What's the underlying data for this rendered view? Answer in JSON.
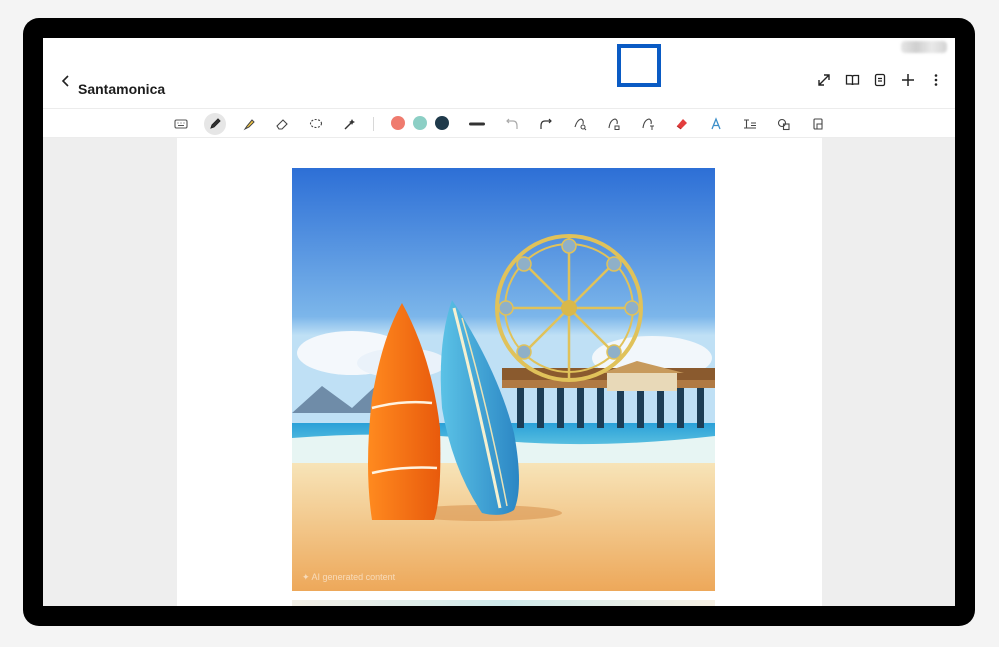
{
  "header": {
    "title": "Santamonica",
    "back_icon": "chevron-left-icon",
    "actions": [
      "expand-icon",
      "book-icon",
      "page-list-icon",
      "plus-icon",
      "more-vertical-icon"
    ]
  },
  "toolbar": {
    "tools": [
      "keyboard-icon",
      "pen-icon",
      "highlighter-icon",
      "eraser-icon",
      "lasso-icon",
      "magic-icon"
    ],
    "colors": [
      "#ef7b6e",
      "#8ccfc5",
      "#1f3a4b"
    ],
    "actions": [
      "line-width-icon",
      "undo-icon",
      "redo-icon",
      "pen-search-icon",
      "shape-lock-icon",
      "shape-text-icon",
      "red-eraser-icon",
      "text-style-icon",
      "text-box-icon",
      "shapes-icon",
      "lock-icon"
    ],
    "selected_tool": "red-eraser-icon"
  },
  "content": {
    "image_description_icon": "beach-surfboards-ferris-wheel-image"
  },
  "colors": {
    "accent": "#0a5bc4",
    "highlight_red": "#e33d3d"
  }
}
